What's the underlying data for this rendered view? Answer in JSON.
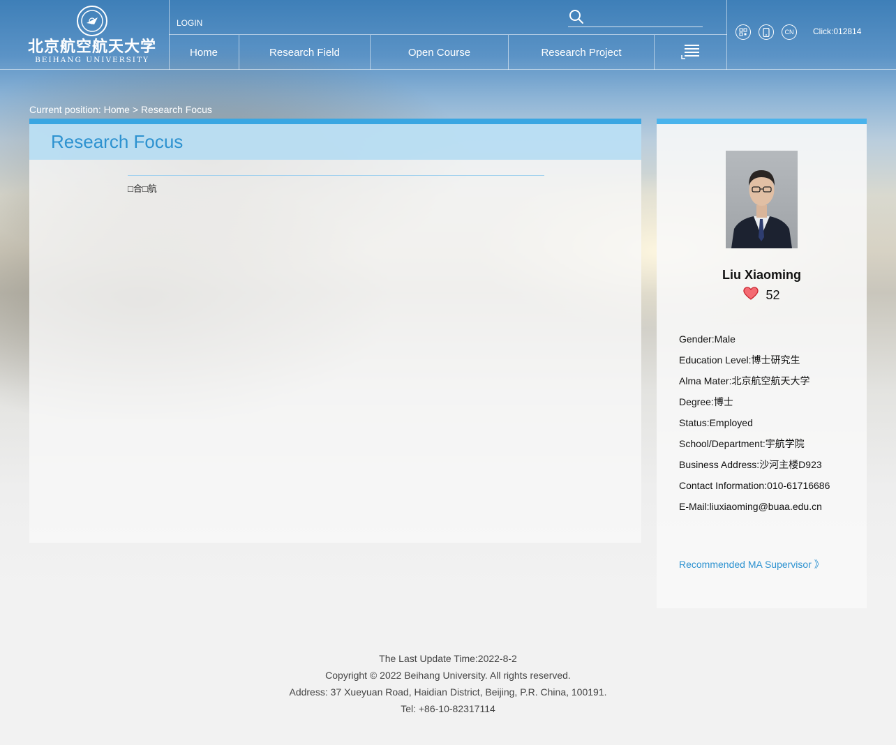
{
  "header": {
    "logo_cn": "北京航空航天大学",
    "logo_en": "BEIHANG UNIVERSITY",
    "login_label": "LOGIN",
    "search_placeholder": "",
    "nav": [
      {
        "label": "Home"
      },
      {
        "label": "Research Field"
      },
      {
        "label": "Open Course"
      },
      {
        "label": "Research Project"
      }
    ],
    "tools": [
      "QR",
      "M",
      "CN"
    ],
    "click_label": "Click:",
    "click_count": "012814"
  },
  "breadcrumb": {
    "prefix": "Current position:",
    "home": "Home",
    "sep": ">",
    "current": "Research Focus"
  },
  "main": {
    "title": "Research Focus",
    "text": "□合□航"
  },
  "profile": {
    "name": "Liu Xiaoming",
    "likes": "52",
    "info": [
      {
        "label": "Gender:",
        "value": "Male"
      },
      {
        "label": "Education Level:",
        "value": "博士研究生"
      },
      {
        "label": "Alma Mater:",
        "value": "北京航空航天大学"
      },
      {
        "label": "Degree:",
        "value": "博士"
      },
      {
        "label": "Status:",
        "value": "Employed"
      },
      {
        "label": "School/Department:",
        "value": "宇航学院"
      },
      {
        "label": "Business Address:",
        "value": "沙河主楼D923"
      },
      {
        "label": "Contact Information:",
        "value": "010-61716686"
      },
      {
        "label": "E-Mail:",
        "value": "liuxiaoming@buaa.edu.cn"
      }
    ],
    "recommend": "Recommended MA Supervisor 》"
  },
  "footer": {
    "update": "The Last Update Time:2022-8-2",
    "copyright": "Copyright © 2022 Beihang University. All rights reserved.",
    "address": "Address: 37 Xueyuan Road, Haidian District, Beijing, P.R. China, 100191.",
    "tel": "Tel: +86-10-82317114"
  },
  "colors": {
    "accent": "#2d92d0",
    "bar": "#3aa6e2",
    "heart": "#e8343e"
  }
}
